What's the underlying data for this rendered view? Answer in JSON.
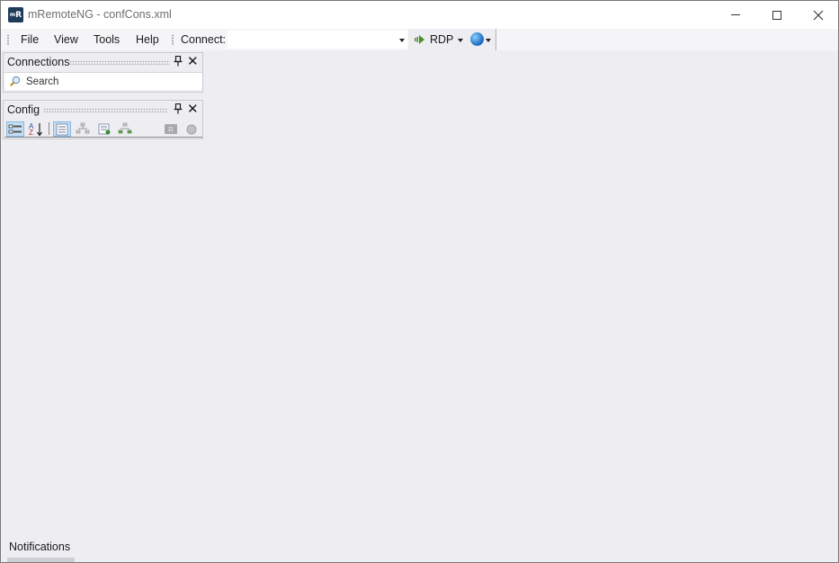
{
  "window": {
    "logo_text": "R",
    "title": "mRemoteNG - confCons.xml"
  },
  "menu": {
    "items": [
      "File",
      "View",
      "Tools",
      "Help"
    ]
  },
  "quick_connect": {
    "label": "Connect:",
    "value": "",
    "protocol": "RDP"
  },
  "connections_panel": {
    "title": "Connections",
    "search_placeholder": "Search"
  },
  "config_panel": {
    "title": "Config"
  },
  "notifications": {
    "label": "Notifications"
  },
  "colors": {
    "workspace": "#eeeef2",
    "title_bar": "#ffffff",
    "active_button": "#c5dff5"
  }
}
